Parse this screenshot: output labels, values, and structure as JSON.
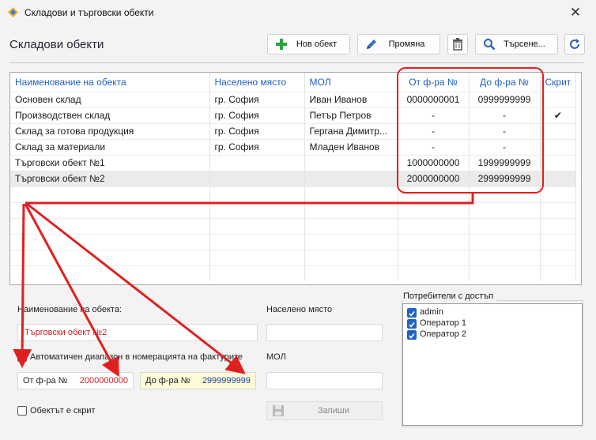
{
  "window": {
    "title": "Складови и търговски обекти",
    "close_label": "✕"
  },
  "section": {
    "title": "Складови обекти"
  },
  "toolbar": {
    "new_label": "Нов обект",
    "edit_label": "Промяна",
    "search_label": "Търсене..."
  },
  "grid": {
    "columns": [
      "Наименование на обекта",
      "Населено място",
      "МОЛ",
      "От ф-ра №",
      "До ф-ра №",
      "Скрит"
    ],
    "rows": [
      {
        "name": "Основен склад",
        "city": "гр. София",
        "mol": "Иван Иванов",
        "from": "0000000001",
        "to": "0999999999",
        "hidden": ""
      },
      {
        "name": "Производствен склад",
        "city": "гр. София",
        "mol": "Петър Петров",
        "from": "-",
        "to": "-",
        "hidden": "✔"
      },
      {
        "name": "Склад за готова продукция",
        "city": "гр. София",
        "mol": "Гергана Димитр...",
        "from": "-",
        "to": "-",
        "hidden": ""
      },
      {
        "name": "Склад за материали",
        "city": "гр. София",
        "mol": "Младен Иванов",
        "from": "-",
        "to": "-",
        "hidden": ""
      },
      {
        "name": "Търговски обект №1",
        "city": "",
        "mol": "",
        "from": "1000000000",
        "to": "1999999999",
        "hidden": ""
      },
      {
        "name": "Търговски обект №2",
        "city": "",
        "mol": "",
        "from": "2000000000",
        "to": "2999999999",
        "hidden": ""
      }
    ]
  },
  "form": {
    "name_label": "Наименование на обекта:",
    "name_value": "Търговски обект №2",
    "city_label": "Населено място",
    "city_value": "",
    "auto_range_label": "Автоматичен диапазон в номерацията на фактурите",
    "from_label": "От ф-ра №",
    "from_value": "2000000000",
    "to_label": "До ф-ра №",
    "to_value": "2999999999",
    "mol_label": "МОЛ",
    "mol_value": "",
    "hidden_label": "Обектът е скрит",
    "save_label": "Запиши"
  },
  "users": {
    "title": "Потребители с достъп",
    "items": [
      {
        "label": "admin",
        "checked": true
      },
      {
        "label": "Оператор 1",
        "checked": true
      },
      {
        "label": "Оператор 2",
        "checked": true
      }
    ]
  },
  "colors": {
    "annotation": "#e02020",
    "header_text": "#1f5fbf",
    "checkbox": "#1f62c5"
  }
}
